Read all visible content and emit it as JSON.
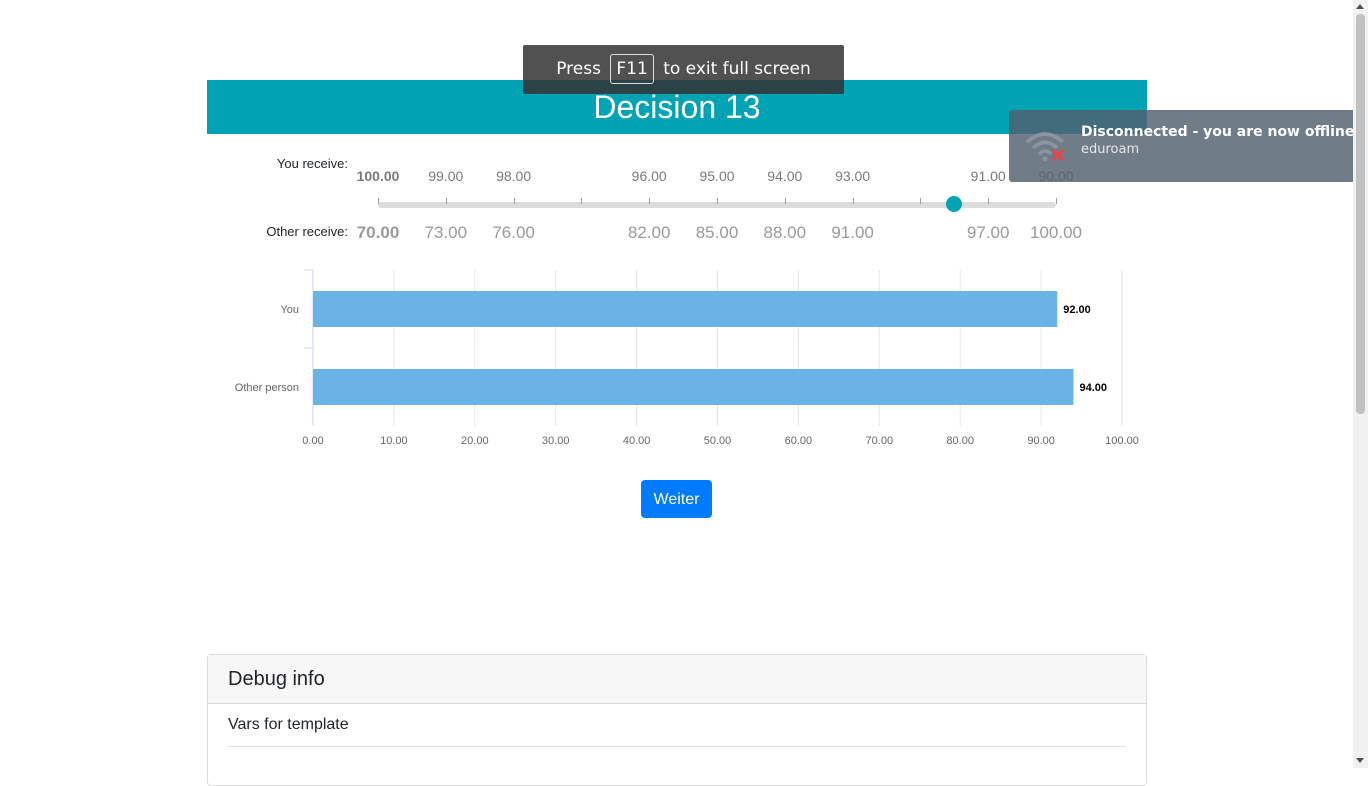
{
  "header": {
    "title": "Decision 13"
  },
  "slider": {
    "you_label": "You receive:",
    "other_label": "Other receive:",
    "you_values": [
      "100.00",
      "99.00",
      "98.00",
      "",
      "96.00",
      "95.00",
      "94.00",
      "93.00",
      "",
      "91.00",
      "90.00"
    ],
    "other_values": [
      "70.00",
      "73.00",
      "76.00",
      "",
      "82.00",
      "85.00",
      "88.00",
      "91.00",
      "",
      "97.00",
      "100.00"
    ],
    "selected_index": 8
  },
  "chart_data": {
    "type": "bar",
    "orientation": "horizontal",
    "categories": [
      "You",
      "Other person"
    ],
    "values": [
      92.0,
      94.0
    ],
    "value_labels": [
      "92.00",
      "94.00"
    ],
    "xlim": [
      0,
      100
    ],
    "xticks": [
      "0.00",
      "10.00",
      "20.00",
      "30.00",
      "40.00",
      "50.00",
      "60.00",
      "70.00",
      "80.00",
      "90.00",
      "100.00"
    ],
    "grid": true,
    "bar_color": "#69b4e5"
  },
  "button": {
    "label": "Weiter"
  },
  "debug": {
    "title": "Debug info",
    "subtitle": "Vars for template"
  },
  "fullscreen": {
    "pre": "Press",
    "key": "F11",
    "post": "to exit full screen"
  },
  "toast": {
    "title": "Disconnected - you are now offline",
    "network": "eduroam",
    "icon": "wifi-disconnected-icon"
  },
  "colors": {
    "header": "#00a3b4",
    "button": "#007bff"
  }
}
